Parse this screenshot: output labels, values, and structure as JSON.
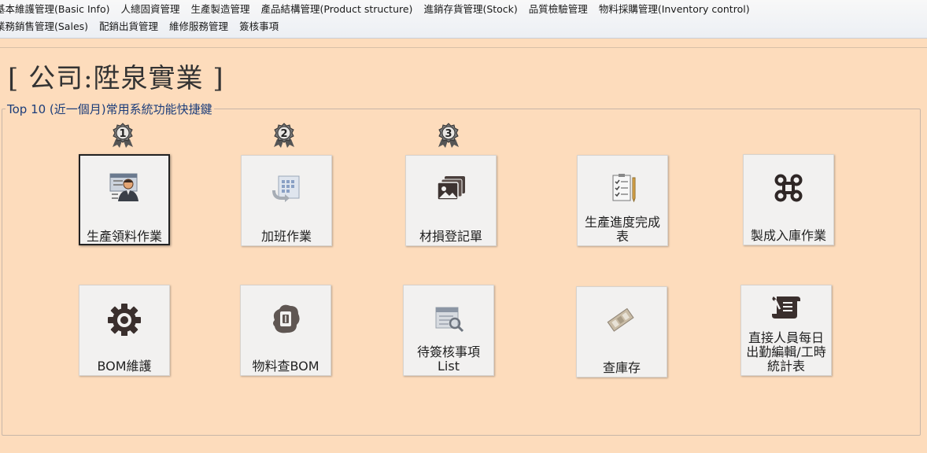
{
  "menu": {
    "row1": [
      "基本維護管理(Basic Info)",
      "人總固資管理",
      "生產製造管理",
      "產品結構管理(Product structure)",
      "進銷存貨管理(Stock)",
      "品質檢驗管理",
      "物料採購管理(Inventory control)"
    ],
    "row2": [
      "業務銷售管理(Sales)",
      "配銷出貨管理",
      "維修服務管理",
      "簽核事項"
    ]
  },
  "company": {
    "title": "[ 公司:陞泉實業 ]"
  },
  "shortcuts": {
    "legend": "Top 10 (近一個月)常用系統功能快捷鍵",
    "ranks": [
      "1",
      "2",
      "3"
    ],
    "tiles": [
      {
        "label": "生產領料作業",
        "icon": "worker-icon",
        "selected": true
      },
      {
        "label": "加班作業",
        "icon": "overtime-icon"
      },
      {
        "label": "材損登記單",
        "icon": "photos-icon"
      },
      {
        "label": "生產進度完成表",
        "icon": "checklist-icon"
      },
      {
        "label": "製成入庫作業",
        "icon": "command-icon"
      },
      {
        "label": "BOM維護",
        "icon": "gear-icon"
      },
      {
        "label": "物料查BOM",
        "icon": "document-icon"
      },
      {
        "label": "待簽核事項List",
        "icon": "inspect-icon"
      },
      {
        "label": "查庫存",
        "icon": "stock-icon"
      },
      {
        "label": "直接人員每日出勤編輯/工時統計表",
        "icon": "scroll-icon"
      }
    ]
  }
}
